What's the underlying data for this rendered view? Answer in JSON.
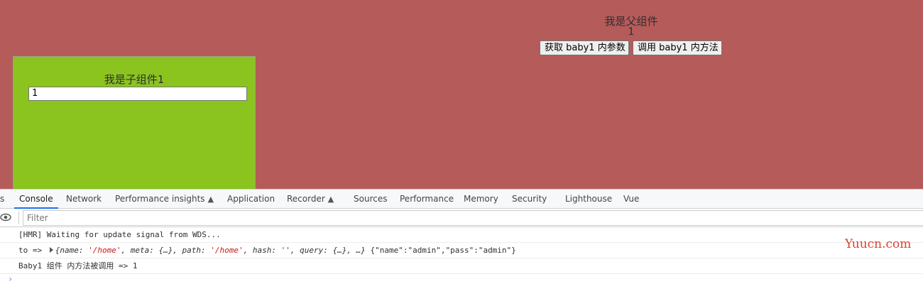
{
  "parent": {
    "title": "我是父组件",
    "count": "1",
    "get_button": "获取 baby1 内参数",
    "call_button": "调用 baby1 内方法"
  },
  "child": {
    "title": "我是子组件1",
    "input_value": "1"
  },
  "devtools": {
    "tabs": [
      {
        "label": "s"
      },
      {
        "label": "Console",
        "active": true
      },
      {
        "label": "Network"
      },
      {
        "label": "Performance insights",
        "icon": "flask-icon"
      },
      {
        "label": "Application"
      },
      {
        "label": "Recorder",
        "icon": "flask-icon"
      },
      {
        "label": "Sources"
      },
      {
        "label": "Performance"
      },
      {
        "label": "Memory"
      },
      {
        "label": "Security"
      },
      {
        "label": "Lighthouse"
      },
      {
        "label": "Vue"
      }
    ],
    "filter_placeholder": "Filter",
    "logs": {
      "line1": "[HMR] Waiting for update signal from WDS...",
      "line2_prefix": "to =>",
      "line2_object": {
        "open": "{name: ",
        "name_value": "'/home'",
        "mid1": ", meta: {…}, path: ",
        "path_value": "'/home'",
        "mid2": ", hash: ",
        "hash_value": "''",
        "tail": ", query: {…}, …}"
      },
      "line2_json": "{\"name\":\"admin\",\"pass\":\"admin\"}",
      "line3": "Baby1 组件 内方法被调用  => 1"
    }
  },
  "watermark": "Yuucn.com",
  "colors": {
    "app_background": "#b55b5a",
    "child_background": "#8bc41f",
    "active_tab_underline": "#1a73e8",
    "console_string": "#c41a16",
    "watermark": "#e0402a"
  }
}
